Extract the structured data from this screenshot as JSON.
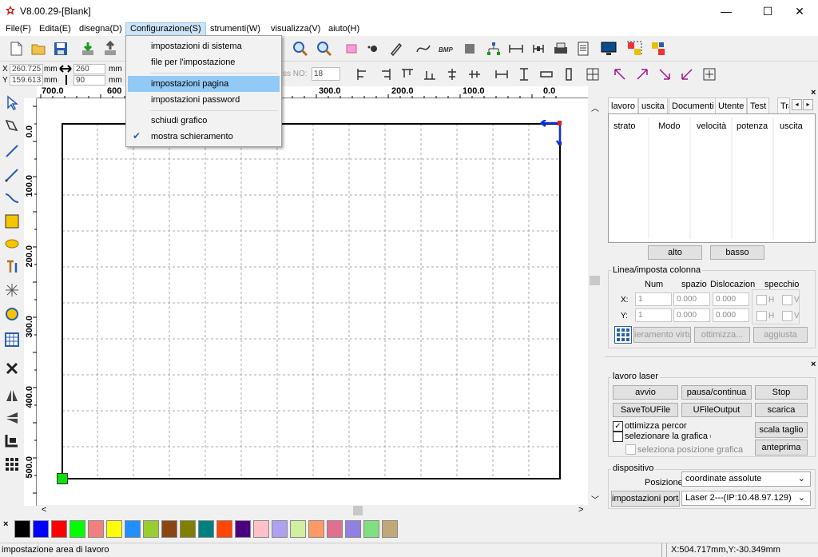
{
  "window": {
    "title": "V8.00.29-[Blank]",
    "minimize_glyph": "—",
    "maximize_glyph": "☐",
    "close_glyph": "✕"
  },
  "menubar": {
    "items": [
      "File(F)",
      "Edita(E)",
      "disegna(D)",
      "Configurazione(S)",
      "strumenti(W)",
      "visualizza(V)",
      "aiuto(H)"
    ],
    "active_index": 3
  },
  "dropdown": {
    "items": [
      "impostazioni di sistema",
      "file per l'impostazione",
      "impostazioni pagina",
      "impostazioni password",
      "schiudi grafico",
      "mostra schieramento"
    ],
    "highlighted": "impostazioni pagina",
    "checked": "mostra schieramento",
    "check_glyph": "✔"
  },
  "coords": {
    "x_label": "X",
    "y_label": "Y",
    "x_value": "260.725",
    "y_value": "159.613",
    "w_value": "260",
    "h_value": "90",
    "unit": "mm",
    "pass_label": "ss NO:",
    "pass_value": "18"
  },
  "rulers": {
    "h_labels": [
      "700.0",
      "600",
      "300.0",
      "200.0",
      "100.0",
      "0.0"
    ],
    "v_labels": [
      "0.0",
      "100.0",
      "200.0",
      "300.0",
      "400.0",
      "500.0"
    ]
  },
  "right_panel": {
    "tabs": [
      "lavoro",
      "uscita",
      "Documenti",
      "Utente",
      "Test",
      "Tra"
    ],
    "columns": [
      "strato",
      "Modo",
      "velocità",
      "potenza",
      "uscita"
    ],
    "btn_up": "alto",
    "btn_down": "basso",
    "array_group": "Linea/imposta colonna",
    "array_headers": [
      "Num",
      "spazio",
      "Dislocazione",
      "specchio"
    ],
    "row_x": {
      "label": "X:",
      "num": "1",
      "space": "0.000",
      "disloc": "0.000",
      "mirror": "H",
      "mirror2": "V"
    },
    "row_y": {
      "label": "Y:",
      "num": "1",
      "space": "0.000",
      "disloc": "0.000",
      "mirror": "H",
      "mirror2": "V"
    },
    "btn_virtual": "ieramento virtu",
    "btn_optimize": "ottimizza...",
    "btn_adjust": "aggiusta",
    "laser_group": "lavoro laser",
    "btn_start": "avvio",
    "btn_pause": "pausa/continua",
    "btn_stop": "Stop",
    "btn_save": "SaveToUFile",
    "btn_ufile": "UFileOutput",
    "btn_download": "scarica",
    "chk_optimize": "ottimizza percor",
    "chk_select": "selezionare la grafica d'\\",
    "chk_position": "seleziona posizione grafica",
    "btn_cut_scale": "scala taglio",
    "btn_preview": "anteprima",
    "device_group": "dispositivo",
    "position_label": "Posizione:",
    "position_value": "coordinate assolute",
    "btn_port": "impostazioni porta",
    "laser_value": "Laser 2---(IP:10.48.97.129)"
  },
  "palette": {
    "close_glyph": "×",
    "colors": [
      "#000000",
      "#0000ff",
      "#ff0000",
      "#00ff00",
      "#f08080",
      "#ffff00",
      "#1e90ff",
      "#9acd32",
      "#8b4513",
      "#808000",
      "#008080",
      "#ff4500",
      "#4b0082",
      "#ffc0cb",
      "#b0a0f0",
      "#d0f0a0",
      "#ff9966",
      "#e07090",
      "#9080e0",
      "#80e080",
      "#c0a878"
    ]
  },
  "status": {
    "message": "impostazione area di lavoro",
    "coords": "X:504.717mm,Y:-30.349mm"
  }
}
